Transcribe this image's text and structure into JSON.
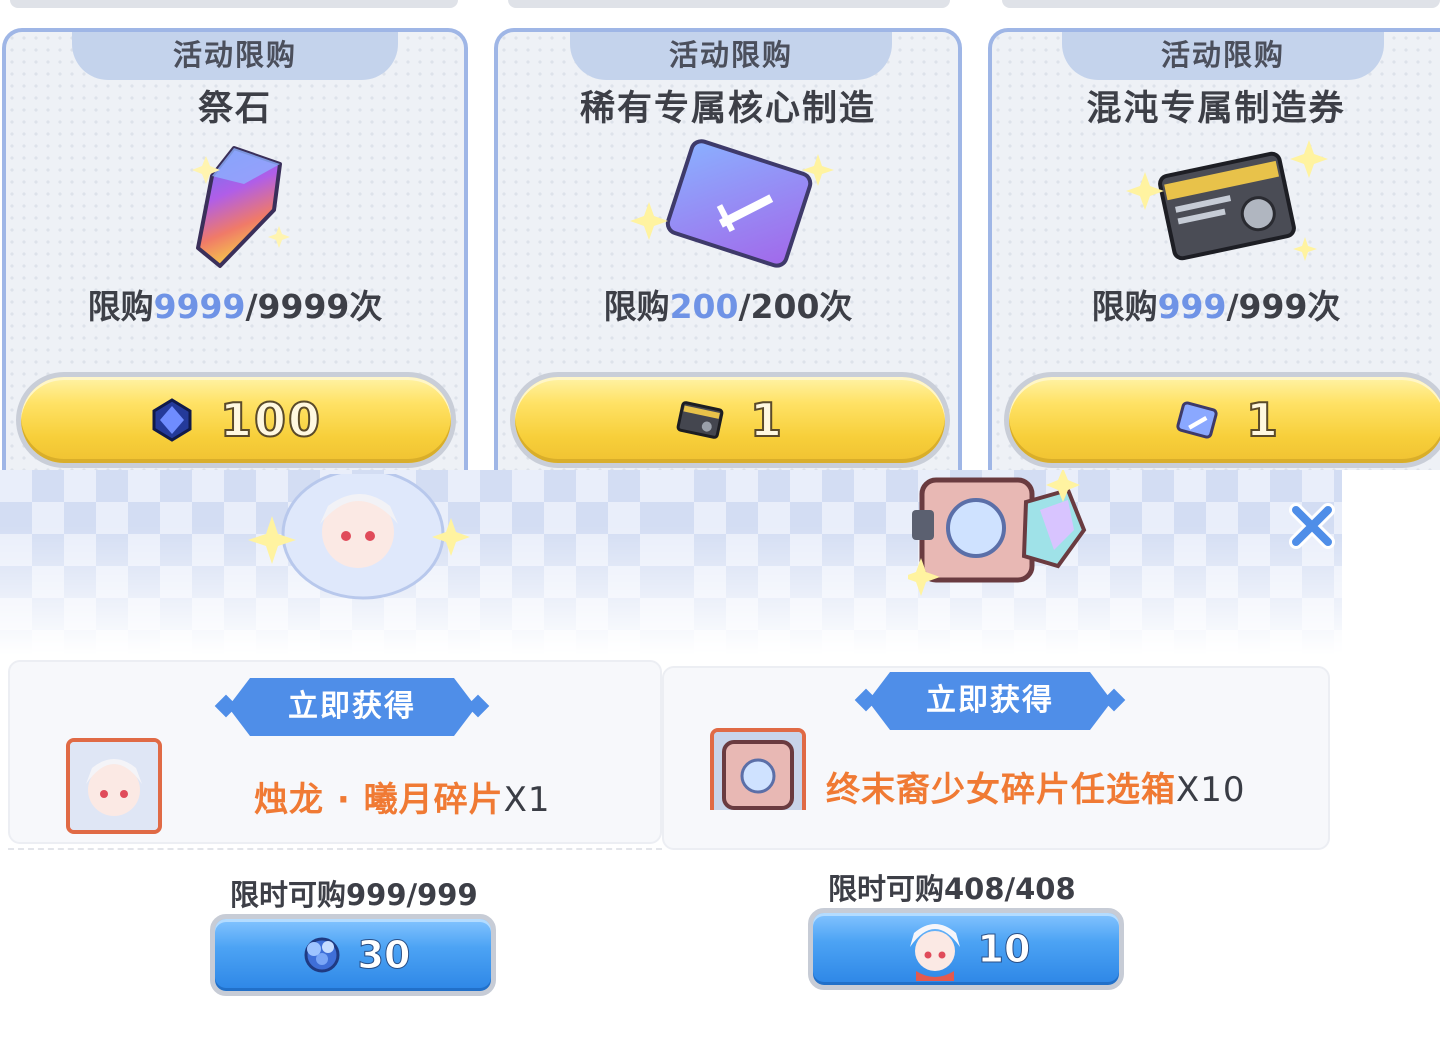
{
  "shop_cards": [
    {
      "tag": "活动限购",
      "name": "祭石",
      "limit_prefix": "限购",
      "limit_current": "9999",
      "limit_total": "/9999",
      "limit_suffix": "次",
      "price": "100",
      "currency_icon": "blue-crystal-icon",
      "item_icon": "gem-stone-icon"
    },
    {
      "tag": "活动限购",
      "name": "稀有专属核心制造",
      "limit_prefix": "限购",
      "limit_current": "200",
      "limit_total": "/200",
      "limit_suffix": "次",
      "price": "1",
      "currency_icon": "ticket-card-icon",
      "item_icon": "sword-card-icon"
    },
    {
      "tag": "活动限购",
      "name": "混沌专属制造券",
      "limit_prefix": "限购",
      "limit_current": "999",
      "limit_total": "/999",
      "limit_suffix": "次",
      "price": "1",
      "currency_icon": "sword-card-icon",
      "item_icon": "ticket-card-icon"
    }
  ],
  "popups": [
    {
      "ribbon": "立即获得",
      "reward_name": "烛龙 · 曦月碎片",
      "reward_qty": "X1",
      "time_limit": "限时可购999/999",
      "price": "30",
      "currency_icon": "blue-flower-icon",
      "reward_icon": "character-portrait-icon"
    },
    {
      "ribbon": "立即获得",
      "reward_name": "终末裔少女碎片任选箱",
      "reward_qty": "X10",
      "time_limit": "限时可购408/408",
      "price": "10",
      "currency_icon": "character-portrait-icon",
      "reward_icon": "chest-box-icon"
    }
  ],
  "colors": {
    "accent_blue": "#4f8ee8",
    "highlight": "#6f93e6",
    "reward_orange": "#f07a34",
    "button_yellow": "#f7cf3a"
  }
}
